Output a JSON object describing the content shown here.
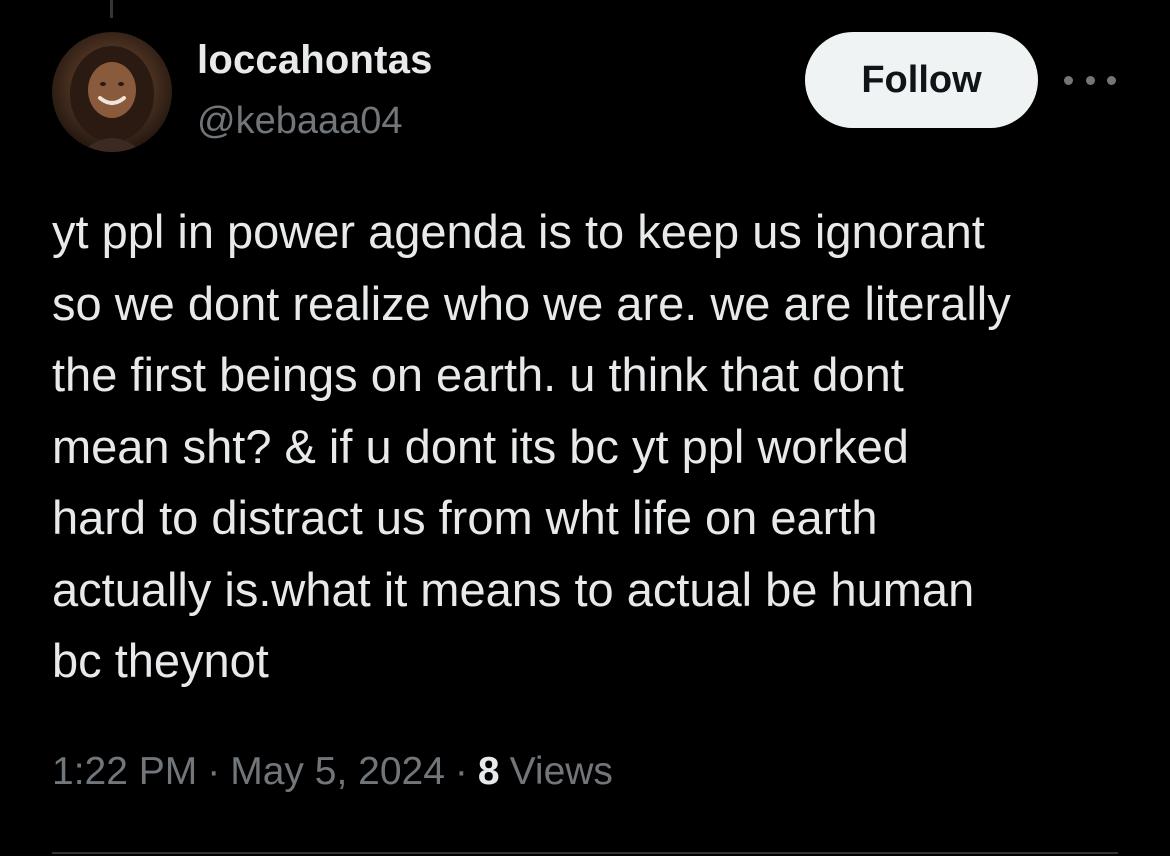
{
  "author": {
    "display_name": "loccahontas",
    "handle": "@kebaaa04"
  },
  "actions": {
    "follow_label": "Follow",
    "more_icon": "more-horizontal-icon"
  },
  "tweet": {
    "text": "yt ppl in power agenda is to keep us ignorant\nso we dont realize who we are. we are literally\nthe first beings on earth. u think that dont\nmean sht? & if u dont its bc yt ppl worked\nhard to distract us from wht life on earth\nactually is.what it means to actual be human\nbc theynot",
    "time": "1:22 PM",
    "date": "May 5, 2024",
    "separator": "·",
    "views_count": "8",
    "views_label": "Views"
  },
  "colors": {
    "background": "#000000",
    "primary_text": "#e7e9ea",
    "secondary_text": "#71767b",
    "follow_button_bg": "#eff3f4"
  }
}
